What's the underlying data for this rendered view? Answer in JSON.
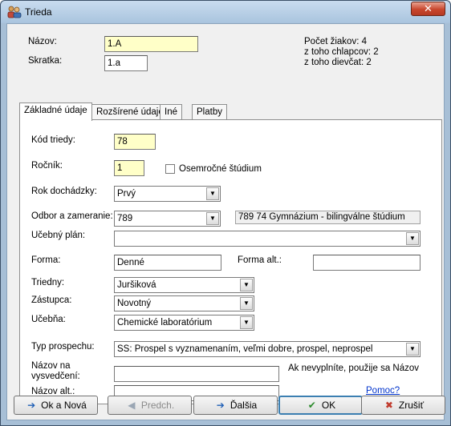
{
  "window": {
    "title": "Trieda",
    "close_label": "✕"
  },
  "header": {
    "nazov_label": "Názov:",
    "nazov_value": "1.A",
    "skratka_label": "Skratka:",
    "skratka_value": "1.a",
    "stats": {
      "pocet": "Počet žiakov: 4",
      "chlapcov": "z toho chlapcov: 2",
      "dievcat": "z toho dievčat: 2"
    }
  },
  "tabs": [
    {
      "label": "Základné údaje",
      "active": true
    },
    {
      "label": "Rozšírené údaje",
      "active": false
    },
    {
      "label": "Iné",
      "active": false
    },
    {
      "label": "Platby",
      "active": false
    }
  ],
  "form": {
    "kod_label": "Kód triedy:",
    "kod_value": "78",
    "rocnik_label": "Ročník:",
    "rocnik_value": "1",
    "osemrocne_label": "Osemročné štúdium",
    "osemrocne_checked": false,
    "rok_label": "Rok dochádzky:",
    "rok_value": "Prvý",
    "odbor_label": "Odbor a zameranie:",
    "odbor_value": "789",
    "odbor_desc": "789 74 Gymnázium - bilingválne štúdium",
    "plan_label": "Učebný plán:",
    "plan_value": "",
    "forma_label": "Forma:",
    "forma_value": "Denné",
    "forma_alt_label": "Forma alt.:",
    "forma_alt_value": "",
    "triedny_label": "Triedny:",
    "triedny_value": "Juršiková",
    "zastupca_label": "Zástupca:",
    "zastupca_value": "Novotný",
    "ucebna_label": "Učebňa:",
    "ucebna_value": "Chemické laboratórium",
    "typ_label": "Typ prospechu:",
    "typ_value": "SŠ: Prospel s vyznamenaním, veľmi dobre, prospel, neprospel",
    "nazov_vysv_label_1": "Názov na",
    "nazov_vysv_label_2": "vysvedčení:",
    "nazov_vysv_value": "",
    "hint": "Ak nevyplníte, použije sa Názov",
    "nazov_alt_label": "Názov alt.:",
    "nazov_alt_value": "",
    "help_link": "Pomoc?"
  },
  "buttons": {
    "ok_nova": "Ok a Nová",
    "predch": "Predch.",
    "dalsia": "Ďalšia",
    "ok": "OK",
    "zrusit": "Zrušiť"
  }
}
